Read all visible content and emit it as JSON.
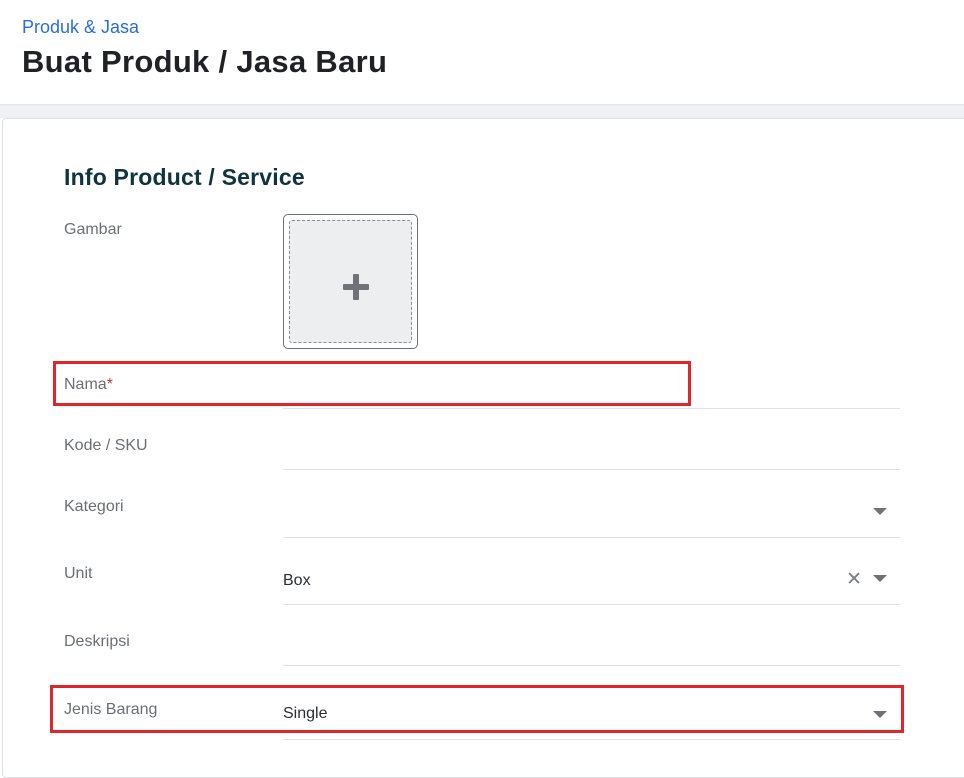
{
  "header": {
    "breadcrumb": "Produk & Jasa",
    "title": "Buat Produk / Jasa Baru"
  },
  "form": {
    "section_title": "Info Product / Service",
    "gambar": {
      "label": "Gambar",
      "icon": "plus-icon"
    },
    "nama": {
      "label": "Nama",
      "required_mark": "*",
      "value": ""
    },
    "kode": {
      "label": "Kode / SKU",
      "value": ""
    },
    "kategori": {
      "label": "Kategori",
      "value": ""
    },
    "unit": {
      "label": "Unit",
      "value": "Box"
    },
    "deskripsi": {
      "label": "Deskripsi",
      "value": ""
    },
    "jenis_barang": {
      "label": "Jenis Barang",
      "value": "Single"
    }
  },
  "colors": {
    "breadcrumb": "#2a6be2",
    "section_title": "#0f3440",
    "required": "#d32f2f",
    "highlight": "#e0252b"
  }
}
